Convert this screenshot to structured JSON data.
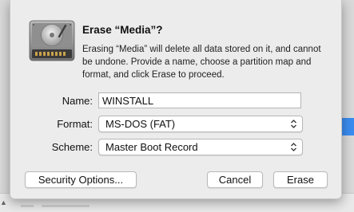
{
  "dialog": {
    "title": "Erase “Media”?",
    "message": "Erasing “Media” will delete all data stored on it, and cannot be undone. Provide a name, choose a partition map and format, and click Erase to proceed.",
    "icon": "hard-drive-icon"
  },
  "form": {
    "name_label": "Name:",
    "name_value": "WINSTALL",
    "format_label": "Format:",
    "format_value": "MS-DOS (FAT)",
    "scheme_label": "Scheme:",
    "scheme_value": "Master Boot Record"
  },
  "buttons": {
    "security_options": "Security Options...",
    "cancel": "Cancel",
    "erase": "Erase"
  },
  "colors": {
    "sheet_background": "#ececec",
    "accent": "#3b8cf0"
  }
}
